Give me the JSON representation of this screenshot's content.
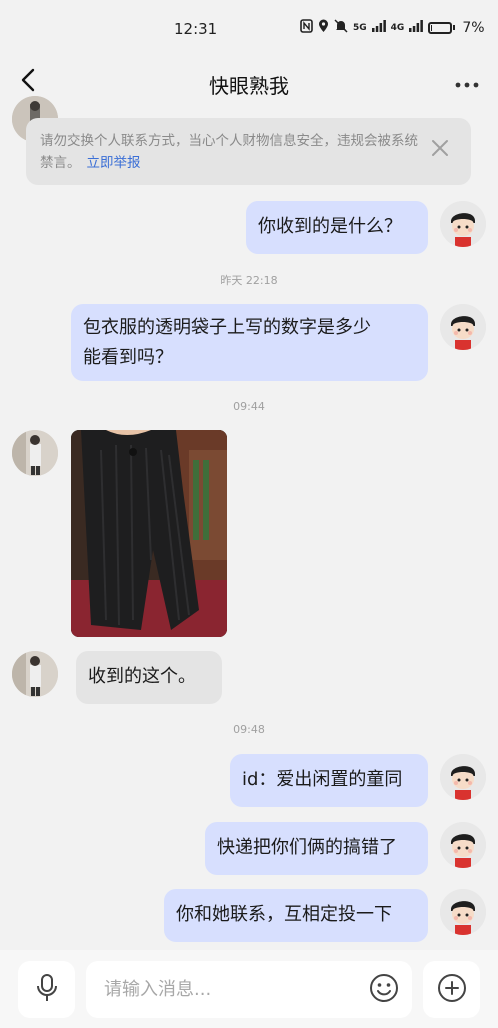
{
  "status_bar": {
    "time": "12:31",
    "signal_1": "5G",
    "signal_2": "4G",
    "battery_percent": "7%",
    "battery_level": 0.07,
    "icons": [
      "nfc-icon",
      "location-icon",
      "mute-bell-icon",
      "signal-icon",
      "battery-icon"
    ]
  },
  "header": {
    "title": "快眼熟我",
    "back_icon": "back-arrow-icon",
    "more_icon": "more-dots-icon"
  },
  "notice": {
    "text": "请勿交换个人联系方式，当心个人财物信息安全，违规会被系统禁言。",
    "report_link": "立即举报",
    "close_icon": "close-icon"
  },
  "messages": [
    {
      "sender": "me",
      "text": "你收到的是什么？"
    },
    {
      "type": "timestamp",
      "text": "昨天 22:18"
    },
    {
      "sender": "me",
      "lines": [
        "包衣服的透明袋子上写的数字是多少",
        "能看到吗？"
      ]
    },
    {
      "type": "timestamp",
      "text": "09:44"
    },
    {
      "sender": "other",
      "type": "image",
      "description": "photo-message"
    },
    {
      "sender": "other",
      "text": "收到的这个。"
    },
    {
      "type": "timestamp",
      "text": "09:48"
    },
    {
      "sender": "me",
      "text": "id：爱出闲置的童同"
    },
    {
      "sender": "me",
      "text": "快递把你们俩的搞错了"
    },
    {
      "sender": "me",
      "text": "你和她联系，互相定投一下"
    }
  ],
  "input_bar": {
    "placeholder": "请输入消息...",
    "mic_icon": "microphone-icon",
    "emoji_icon": "emoji-icon",
    "plus_icon": "plus-circle-icon"
  },
  "colors": {
    "background": "#f2f2f2",
    "my_bubble": "#d7dffe",
    "other_bubble": "#e4e4e4",
    "link": "#3b6fd6"
  }
}
